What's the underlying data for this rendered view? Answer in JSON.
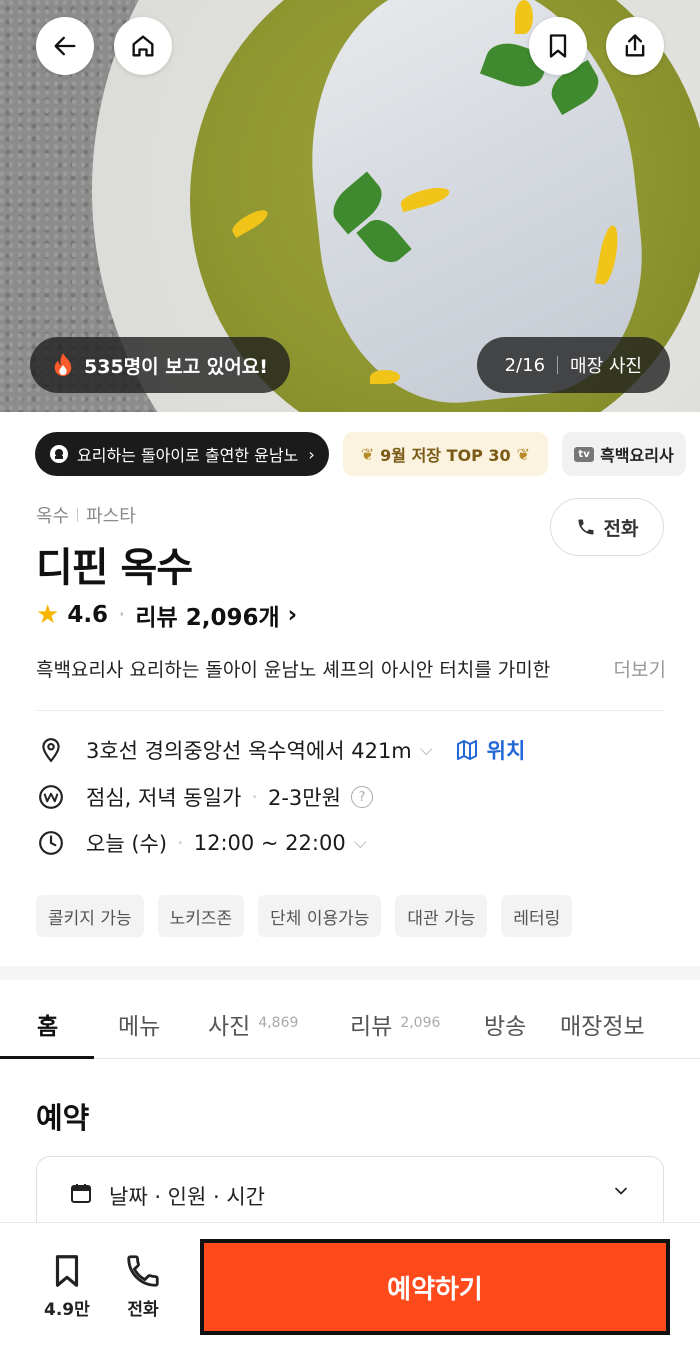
{
  "hero": {
    "viewers_text": "535명이 보고 있어요!",
    "photo_counter": "2/16",
    "photo_label": "매장 사진"
  },
  "badges": {
    "tv_story": "요리하는 돌아이로 출연한 윤남노",
    "ranking": "9월 저장 TOP 30",
    "show_icon_text": "tv",
    "show": "흑백요리사"
  },
  "restaurant": {
    "area": "옥수",
    "category": "파스타",
    "call_label": "전화",
    "name": "디핀 옥수",
    "rating": "4.6",
    "reviews": "리뷰 2,096개",
    "description": "흑백요리사 요리하는 돌아이 윤남노 셰프의 아시안 터치를 가미한",
    "more": "더보기"
  },
  "info": {
    "location": "3호선 경의중앙선 옥수역에서 421m",
    "location_link": "위치",
    "price_meal": "점심, 저녁 동일가",
    "price_range": "2-3만원",
    "hours_day": "오늘 (수)",
    "hours_time": "12:00 ~ 22:00"
  },
  "tags": [
    "콜키지 가능",
    "노키즈존",
    "단체 이용가능",
    "대관 가능",
    "레터링"
  ],
  "tabs": [
    {
      "label": "홈",
      "count": ""
    },
    {
      "label": "메뉴",
      "count": ""
    },
    {
      "label": "사진",
      "count": "4,869"
    },
    {
      "label": "리뷰",
      "count": "2,096"
    },
    {
      "label": "방송",
      "count": ""
    },
    {
      "label": "매장정보",
      "count": ""
    }
  ],
  "reservation": {
    "title": "예약",
    "selector_placeholder": "날짜 · 인원 · 시간"
  },
  "bottom_bar": {
    "save_count": "4.9만",
    "call_label": "전화",
    "reserve_label": "예약하기"
  },
  "colors": {
    "accent": "#ff4a1c",
    "link": "#2167d8",
    "star": "#f7b500"
  }
}
